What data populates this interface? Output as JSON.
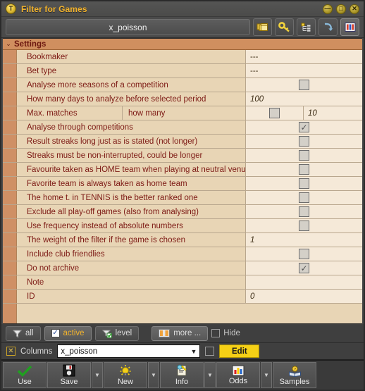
{
  "window": {
    "title": "Filter for Games",
    "app_icon": "coin-icon",
    "buttons": [
      {
        "name": "minimize-button",
        "glyph": "—"
      },
      {
        "name": "maximize-button",
        "glyph": "□"
      },
      {
        "name": "close-button",
        "glyph": "✕"
      }
    ]
  },
  "header": {
    "name_value": "x_poisson",
    "name_placeholder": "filter name",
    "tools": [
      {
        "name": "open-folder-button",
        "icon": "folder-stack-icon"
      },
      {
        "name": "key-button",
        "icon": "key-icon"
      },
      {
        "name": "tree-list-button",
        "icon": "tree-list-icon"
      },
      {
        "name": "redo-button",
        "icon": "curved-arrow-icon"
      },
      {
        "name": "bars-button",
        "icon": "color-bars-icon"
      }
    ]
  },
  "settings": {
    "group_label": "Settings",
    "chevron": "⌄",
    "rows": [
      {
        "label": "Bookmaker",
        "type": "text",
        "value": "---",
        "italic": false
      },
      {
        "label": "Bet type",
        "type": "text",
        "value": "---",
        "italic": false
      },
      {
        "label": "Analyse more seasons of a competition",
        "type": "checkbox",
        "checked": false
      },
      {
        "label": "How many days to analyze before selected period",
        "type": "text",
        "value": "100",
        "italic": true
      },
      {
        "label": "Max. matches",
        "sublabel": "how many",
        "type": "split",
        "checked": false,
        "value": "10"
      },
      {
        "label": "Analyse through competitions",
        "type": "checkbox",
        "checked": true
      },
      {
        "label": "Result streaks long just as is stated (not longer)",
        "type": "checkbox",
        "checked": false
      },
      {
        "label": "Streaks must be non-interrupted, could be longer",
        "type": "checkbox",
        "checked": false
      },
      {
        "label": "Favourite taken as HOME team when playing at neutral venue",
        "type": "checkbox",
        "checked": false
      },
      {
        "label": "Favorite team is always taken as home team",
        "type": "checkbox",
        "checked": false
      },
      {
        "label": "The home t. in TENNIS is the better ranked one",
        "type": "checkbox",
        "checked": false
      },
      {
        "label": "Exclude all play-off games (also from analysing)",
        "type": "checkbox",
        "checked": false
      },
      {
        "label": "Use frequency instead of absolute numbers",
        "type": "checkbox",
        "checked": false
      },
      {
        "label": "The weight of the filter if the game is chosen",
        "type": "text",
        "value": "1",
        "italic": true
      },
      {
        "label": "Include club friendlies",
        "type": "checkbox",
        "checked": false
      },
      {
        "label": "Do not archive",
        "type": "checkbox",
        "checked": true
      },
      {
        "label": "Note",
        "type": "text",
        "value": "",
        "italic": false
      },
      {
        "label": "ID",
        "type": "text",
        "value": "0",
        "italic": true
      }
    ]
  },
  "filterbar": {
    "all_label": "all",
    "active_label": "active",
    "level_label": "level",
    "more_label": "more ...",
    "hide_label": "Hide",
    "hide_checked": false,
    "active_pressed": true
  },
  "columnsbar": {
    "x_icon": "x-box-icon",
    "columns_label": "Columns",
    "combo_value": "x_poisson",
    "combo_arrow": "▼",
    "extra_checked": false,
    "edit_label": "Edit"
  },
  "bottombar": {
    "buttons": [
      {
        "label": "Use",
        "icon": "check-icon",
        "dropdown": false
      },
      {
        "label": "Save",
        "icon": "floppy-icon",
        "dropdown": true
      },
      {
        "label": "New",
        "icon": "bulb-icon",
        "dropdown": true
      },
      {
        "label": "Info",
        "icon": "document-icon",
        "dropdown": true
      },
      {
        "label": "Odds",
        "icon": "barchart-icon",
        "dropdown": true
      },
      {
        "label": "Samples",
        "icon": "book-icon",
        "dropdown": false
      }
    ]
  },
  "colors": {
    "accent_yellow": "#f2b32c",
    "group_orange": "#d08f5f",
    "row_label_bg": "#e8d5b5",
    "row_value_bg": "#f5e9d8",
    "label_red": "#7d1a15",
    "edit_yellow": "#f5d016"
  }
}
